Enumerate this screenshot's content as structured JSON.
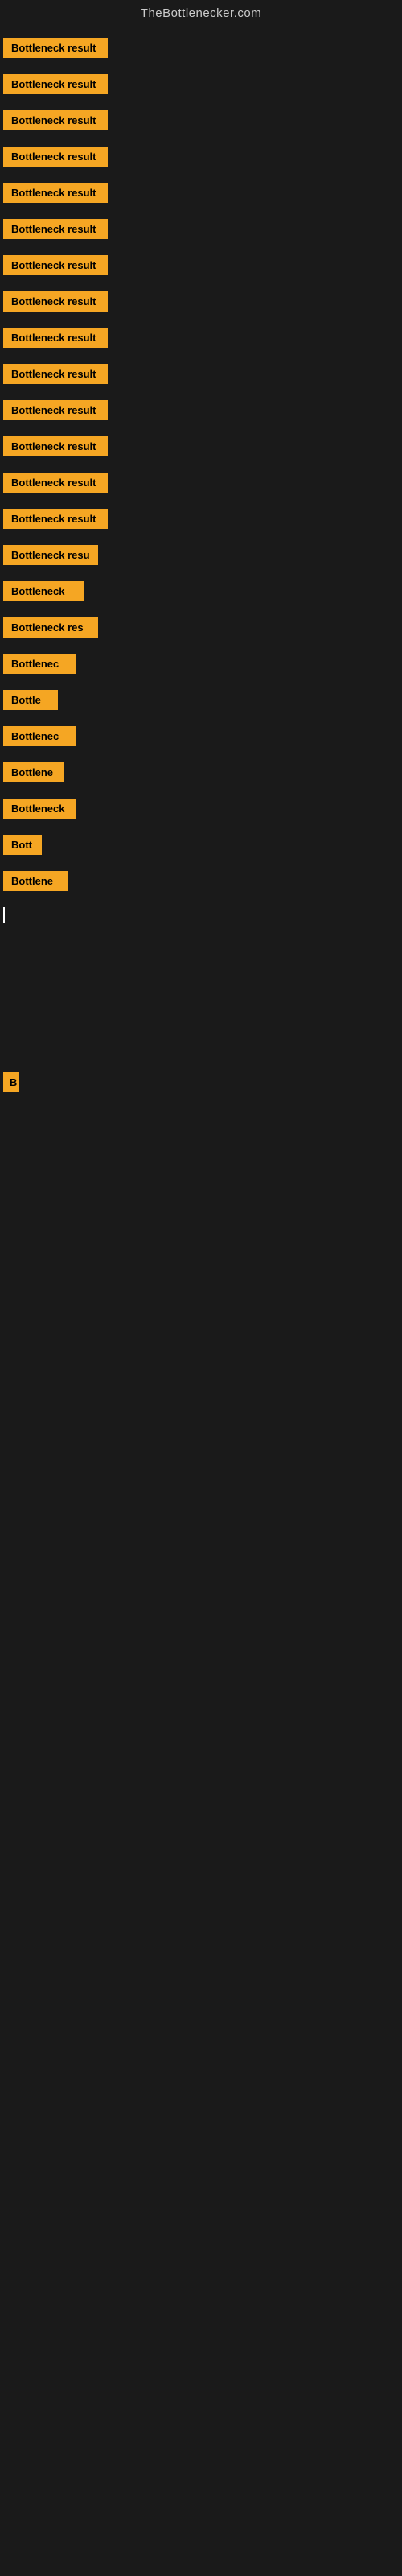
{
  "header": {
    "title": "TheBottlenecker.com"
  },
  "items": [
    {
      "id": 0,
      "label": "Bottleneck result"
    },
    {
      "id": 1,
      "label": "Bottleneck result"
    },
    {
      "id": 2,
      "label": "Bottleneck result"
    },
    {
      "id": 3,
      "label": "Bottleneck result"
    },
    {
      "id": 4,
      "label": "Bottleneck result"
    },
    {
      "id": 5,
      "label": "Bottleneck result"
    },
    {
      "id": 6,
      "label": "Bottleneck result"
    },
    {
      "id": 7,
      "label": "Bottleneck result"
    },
    {
      "id": 8,
      "label": "Bottleneck result"
    },
    {
      "id": 9,
      "label": "Bottleneck result"
    },
    {
      "id": 10,
      "label": "Bottleneck result"
    },
    {
      "id": 11,
      "label": "Bottleneck result"
    },
    {
      "id": 12,
      "label": "Bottleneck result"
    },
    {
      "id": 13,
      "label": "Bottleneck result"
    },
    {
      "id": 14,
      "label": "Bottleneck resu"
    },
    {
      "id": 15,
      "label": "Bottleneck"
    },
    {
      "id": 16,
      "label": "Bottleneck res"
    },
    {
      "id": 17,
      "label": "Bottlenec"
    },
    {
      "id": 18,
      "label": "Bottle"
    },
    {
      "id": 19,
      "label": "Bottlenec"
    },
    {
      "id": 20,
      "label": "Bottlene"
    },
    {
      "id": 21,
      "label": "Bottleneck"
    },
    {
      "id": 22,
      "label": "Bott"
    },
    {
      "id": 23,
      "label": "Bottlene"
    }
  ],
  "cursor": {
    "visible": true
  },
  "lone_b": {
    "label": "B"
  },
  "colors": {
    "badge_bg": "#f5a623",
    "badge_text": "#000000",
    "page_bg": "#1a1a1a",
    "header_text": "#cccccc"
  }
}
